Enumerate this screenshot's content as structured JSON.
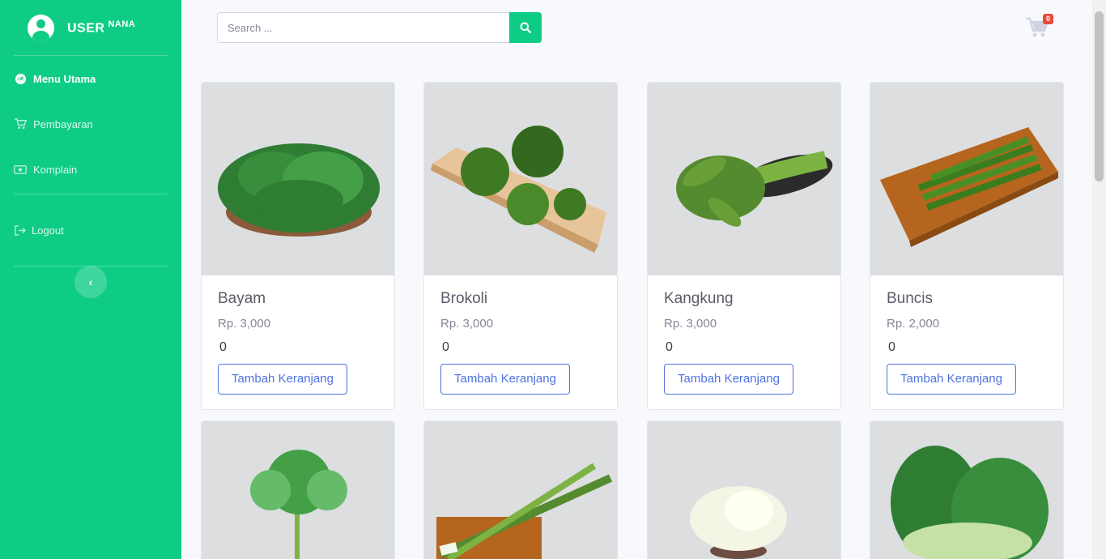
{
  "brand": {
    "user_label": "USER",
    "user_name": "NANA"
  },
  "sidebar": {
    "items": [
      {
        "label": "Menu Utama",
        "icon": "dashboard-icon"
      },
      {
        "label": "Pembayaran",
        "icon": "cart-icon"
      },
      {
        "label": "Komplain",
        "icon": "money-icon"
      },
      {
        "label": "Logout",
        "icon": "logout-icon"
      }
    ],
    "toggle_icon": "chevron-left-icon"
  },
  "search": {
    "placeholder": "Search ...",
    "value": ""
  },
  "cart": {
    "count": "0"
  },
  "colors": {
    "primary": "#0fcc85",
    "button_outline": "#4e73df",
    "badge": "#e74a3b"
  },
  "products": [
    {
      "name": "Bayam",
      "price": "Rp. 3,000",
      "qty": "0",
      "button": "Tambah Keranjang"
    },
    {
      "name": "Brokoli",
      "price": "Rp. 3,000",
      "qty": "0",
      "button": "Tambah Keranjang"
    },
    {
      "name": "Kangkung",
      "price": "Rp. 3,000",
      "qty": "0",
      "button": "Tambah Keranjang"
    },
    {
      "name": "Buncis",
      "price": "Rp. 2,000",
      "qty": "0",
      "button": "Tambah Keranjang"
    }
  ],
  "products_row2": [
    {
      "image": "parsley-image"
    },
    {
      "image": "scallion-image"
    },
    {
      "image": "cabbage-image"
    },
    {
      "image": "bok-choy-image"
    }
  ]
}
